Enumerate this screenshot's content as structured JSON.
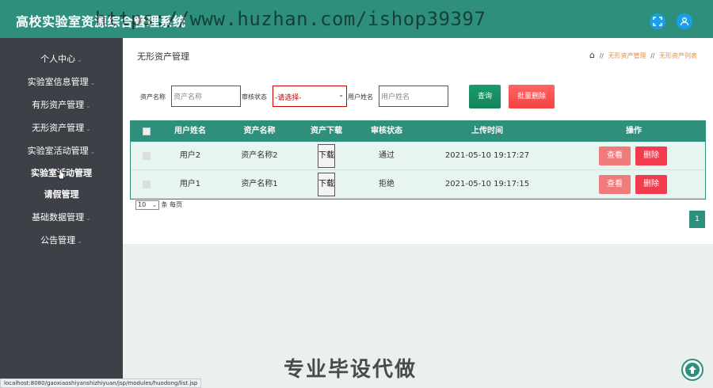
{
  "app": {
    "title": "高校实验室资源综合管理系统",
    "watermark": "https://www.huzhan.com/ishop39397"
  },
  "header_icons": [
    "fullscreen-icon",
    "user-icon"
  ],
  "sidebar": {
    "items": [
      {
        "label": "个人中心",
        "chevron": "⌄"
      },
      {
        "label": "实验室信息管理",
        "chevron": "⌄"
      },
      {
        "label": "有形资产管理",
        "chevron": "⌄"
      },
      {
        "label": "无形资产管理",
        "chevron": "⌄"
      },
      {
        "label": "实验室活动管理",
        "chevron": "⌄"
      },
      {
        "label": "实验室活动管理"
      },
      {
        "label": "请假管理"
      },
      {
        "label": "基础数据管理",
        "chevron": "⌄"
      },
      {
        "label": "公告管理",
        "chevron": "⌄"
      }
    ]
  },
  "page": {
    "title": "无形资产管理",
    "breadcrumb": {
      "sep": "//",
      "items": [
        "无形资产管理",
        "无形资产列表"
      ]
    }
  },
  "filters": {
    "asset_name_label": "资产名称",
    "asset_name_placeholder": "资产名称",
    "review_label": "审核状态",
    "review_value": "-请选择-",
    "user_label": "用户姓名",
    "user_placeholder": "用户姓名",
    "query_btn": "查询",
    "bulk_delete_btn": "批量删除"
  },
  "table": {
    "headers": [
      "用户姓名",
      "资产名称",
      "资产下载",
      "审核状态",
      "上传时间",
      "操作"
    ],
    "rows": [
      {
        "user": "用户2",
        "asset": "资产名称2",
        "download": "下载",
        "status": "通过",
        "time": "2021-05-10 19:17:27",
        "view": "查看",
        "delete": "删除"
      },
      {
        "user": "用户1",
        "asset": "资产名称1",
        "download": "下载",
        "status": "拒绝",
        "time": "2021-05-10 19:17:15",
        "view": "查看",
        "delete": "删除"
      }
    ]
  },
  "pagination": {
    "page_size": "10",
    "suffix": "条 每页",
    "current_page": "1"
  },
  "overlay": {
    "ad_text": "专业毕设代做"
  },
  "statusbar": {
    "url": "localhost:8080/gaoxiaoshiyanshizhiyuan/jsp/modules/huodong/list.jsp"
  },
  "colors": {
    "primary": "#2e8f7d",
    "sidebar": "#3d4046",
    "danger": "#f23c4d",
    "view": "#ef7b7b",
    "crumb": "#e69138"
  }
}
